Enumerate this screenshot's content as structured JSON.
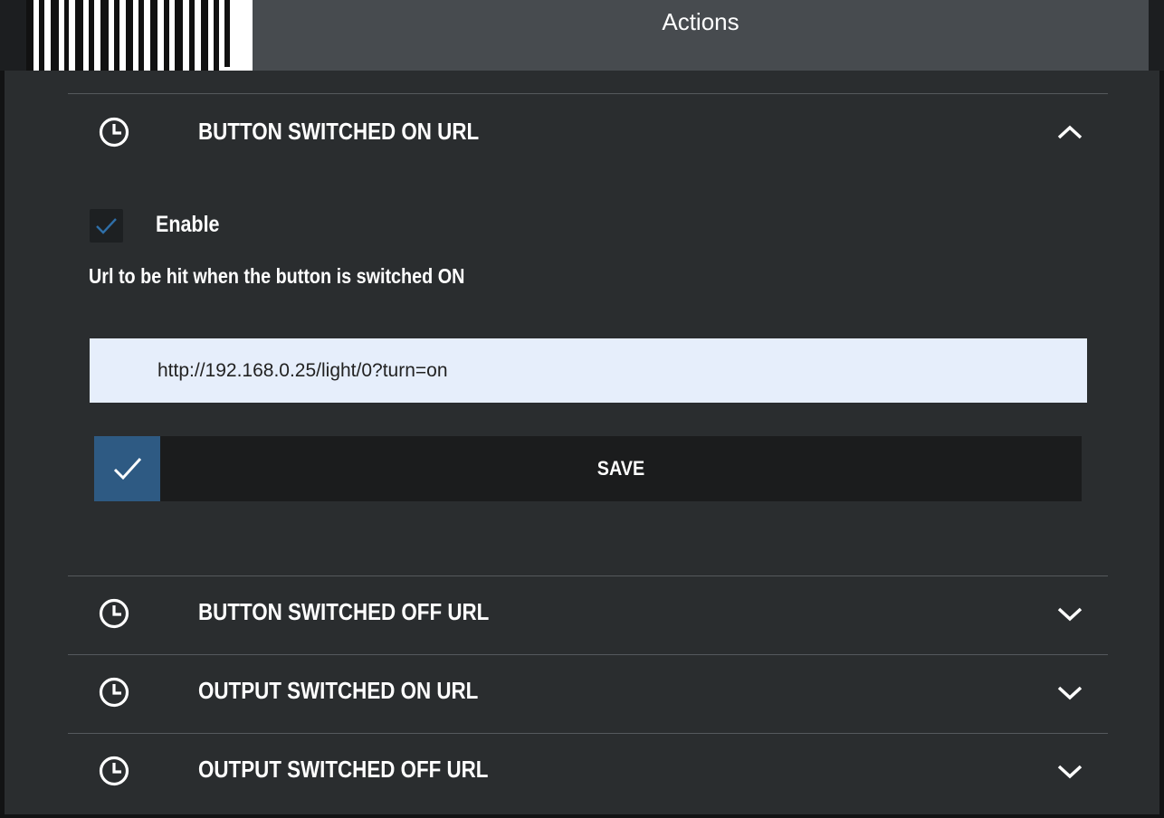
{
  "header": {
    "title": "Actions"
  },
  "sections": [
    {
      "label": "BUTTON SWITCHED ON URL",
      "icon": "clock-icon",
      "expanded": true,
      "chevron": "chevron-up-icon",
      "enable_label": "Enable",
      "enabled": true,
      "description": "Url to be hit when the button is switched ON",
      "url_value": "http://192.168.0.25/light/0?turn=on",
      "save_label": "SAVE"
    },
    {
      "label": "BUTTON SWITCHED OFF URL",
      "icon": "clock-icon",
      "expanded": false,
      "chevron": "chevron-down-icon"
    },
    {
      "label": "OUTPUT SWITCHED ON URL",
      "icon": "clock-icon",
      "expanded": false,
      "chevron": "chevron-down-icon"
    },
    {
      "label": "OUTPUT SWITCHED OFF URL",
      "icon": "clock-icon",
      "expanded": false,
      "chevron": "chevron-down-icon"
    }
  ],
  "colors": {
    "background": "#2a2d2f",
    "header_title_bg": "#474b4f",
    "input_bg": "#e6eefb",
    "save_accent": "#2e5a83",
    "checkbox_tick": "#2f6fa8"
  }
}
